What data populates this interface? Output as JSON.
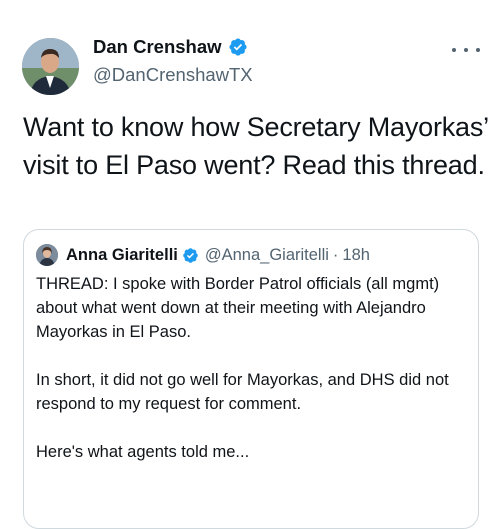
{
  "author": {
    "name": "Dan Crenshaw",
    "handle": "@DanCrenshawTX",
    "avatar_icon": "profile-photo-icon",
    "verified_icon": "verified-badge-icon"
  },
  "more_icon": "more-options-icon",
  "tweet": {
    "text": "Want to know how Secretary Mayorkas’ visit to El Paso went? Read this thread."
  },
  "quoted": {
    "name": "Anna Giaritelli",
    "handle": "@Anna_Giaritelli",
    "separator": "·",
    "time": "18h",
    "paragraphs": [
      "THREAD: I spoke with Border Patrol officials (all mgmt) about what went down at their meeting with Alejandro Mayorkas in El Paso.",
      "In short, it did not go well for Mayorkas, and DHS did not respond to my request for comment.",
      "Here's what agents told me..."
    ]
  },
  "colors": {
    "text": "#0f1419",
    "secondary": "#536471",
    "verified": "#1d9bf0",
    "border": "#cfd9de"
  }
}
